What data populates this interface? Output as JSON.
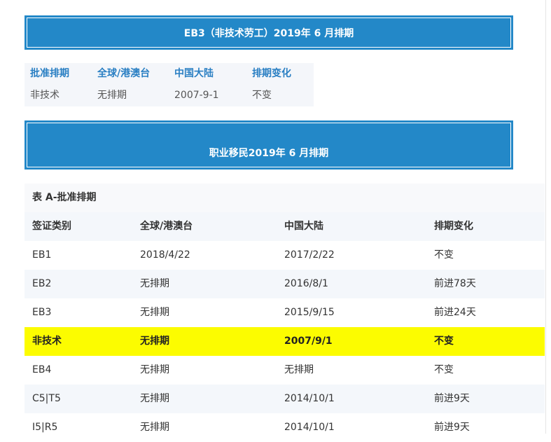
{
  "banners": {
    "eb3_title": "EB3（非技术劳工）2019年 6 月排期",
    "employment_title": "职业移民2019年 6 月排期"
  },
  "eb3_table": {
    "headers": [
      "批准排期",
      "全球/港澳台",
      "中国大陆",
      "排期变化"
    ],
    "row": [
      "非技术",
      "无排期",
      "2007-9-1",
      "不变"
    ]
  },
  "table_a": {
    "caption": "表 A-批准排期",
    "headers": [
      "签证类别",
      "全球/港澳台",
      "中国大陆",
      "排期变化"
    ],
    "rows": [
      [
        "EB1",
        "2018/4/22",
        "2017/2/22",
        "不变"
      ],
      [
        "EB2",
        "无排期",
        "2016/8/1",
        "前进78天"
      ],
      [
        "EB3",
        "无排期",
        "2015/9/15",
        "前进24天"
      ],
      [
        "非技术",
        "无排期",
        "2007/9/1",
        "不变"
      ],
      [
        "EB4",
        "无排期",
        "无排期",
        "不变"
      ],
      [
        "C5|T5",
        "无排期",
        "2014/10/1",
        "前进9天"
      ],
      [
        "I5|R5",
        "无排期",
        "2014/10/1",
        "前进9天"
      ]
    ],
    "highlight_color": "#fcfc00"
  },
  "colors": {
    "banner": "#2388c8",
    "header_text": "#2a7fc3"
  }
}
